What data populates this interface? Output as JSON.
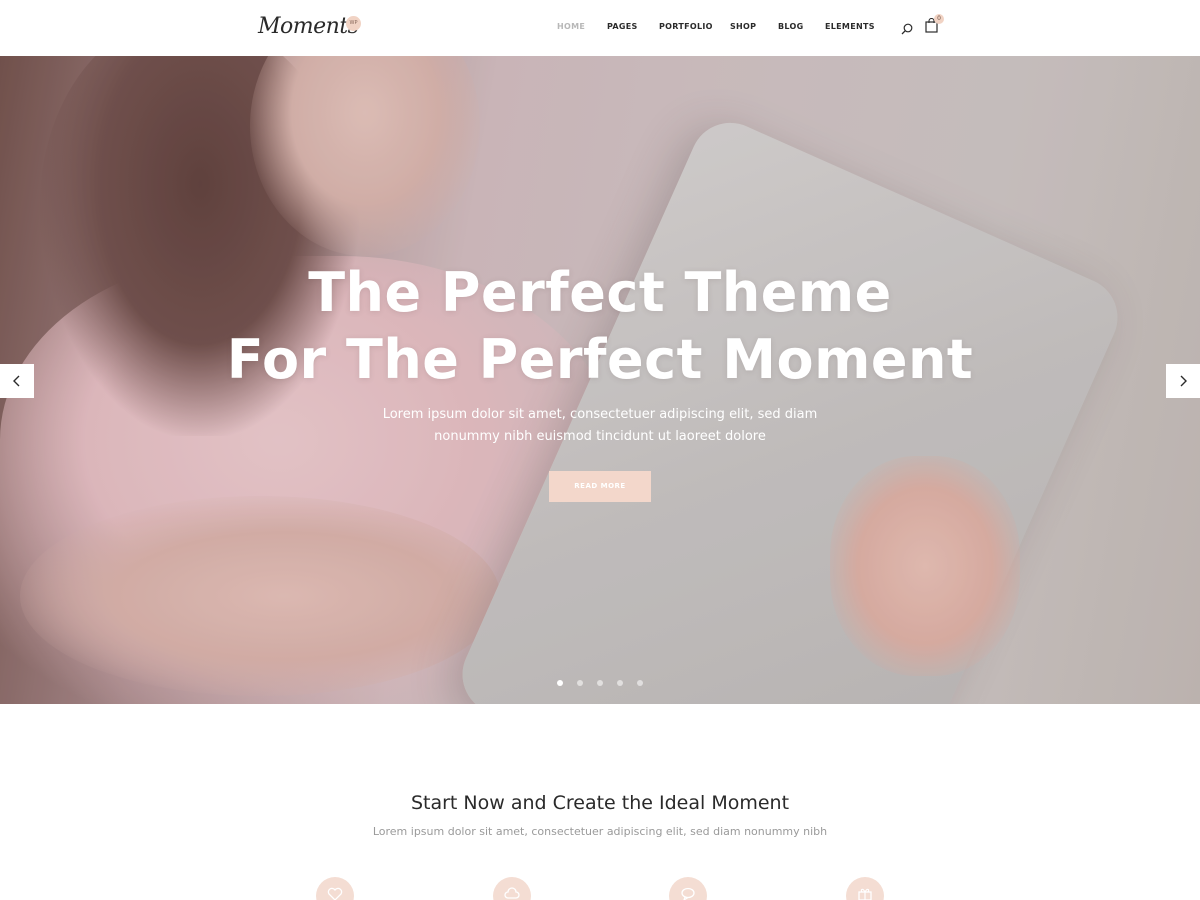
{
  "header": {
    "logo_text": "Moments",
    "logo_badge": "WP",
    "nav": [
      {
        "label": "HOME",
        "active": true
      },
      {
        "label": "PAGES",
        "active": false
      },
      {
        "label": "PORTFOLIO",
        "active": false
      },
      {
        "label": "SHOP",
        "active": false
      },
      {
        "label": "BLOG",
        "active": false
      },
      {
        "label": "ELEMENTS",
        "active": false
      }
    ],
    "search_icon": "search-icon",
    "cart_icon": "shopping-bag-icon",
    "cart_count": "0"
  },
  "hero": {
    "title_line1": "The Perfect Theme",
    "title_line2": "For The Perfect Moment",
    "subtitle_line1": "Lorem ipsum dolor sit amet, consectetuer adipiscing elit, sed diam",
    "subtitle_line2": "nonummy nibh euismod tincidunt ut laoreet dolore",
    "button_label": "READ MORE",
    "prev_icon": "chevron-left-icon",
    "next_icon": "chevron-right-icon",
    "slide_count": 5,
    "active_slide": 1
  },
  "intro": {
    "title": "Start Now and Create the Ideal Moment",
    "subtitle": "Lorem ipsum dolor sit amet, consectetuer adipiscing elit, sed diam nonummy nibh",
    "feature_icons": [
      "heart-icon",
      "cloud-icon",
      "chat-bubble-icon",
      "gift-icon"
    ]
  },
  "colors": {
    "accent": "#f3d7cb",
    "nav_active": "#b8b8b8",
    "text": "#2a2a2a"
  }
}
